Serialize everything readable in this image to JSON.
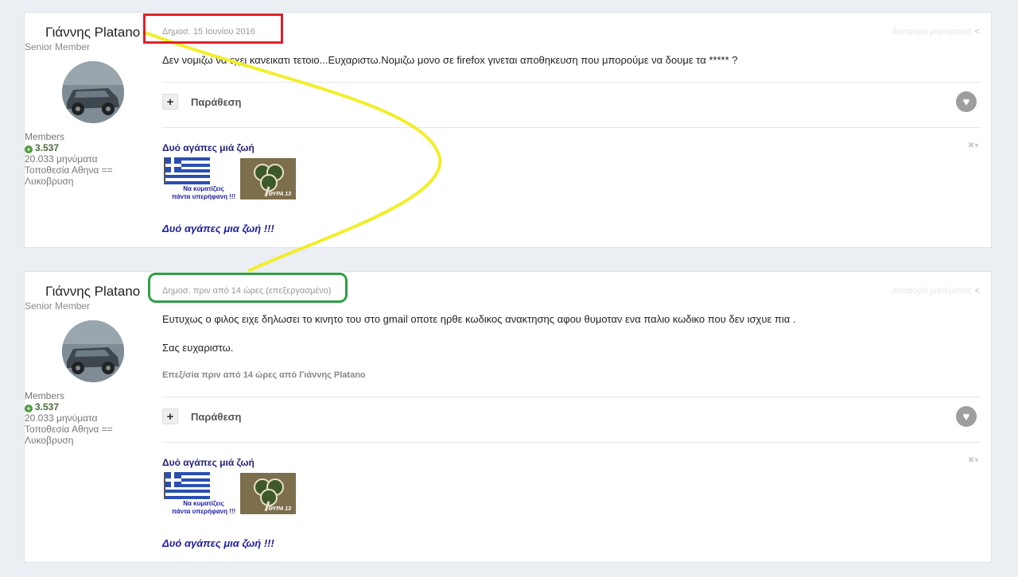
{
  "posts": [
    {
      "author": "Γιάννης Platano",
      "title": "Senior Member",
      "group": "Members",
      "reputation": "3.537",
      "post_count": "20.033 μηνύματα",
      "location_line1": "Τοποθεσία Αθηνα ==",
      "location_line2": "Λυκοβρυση",
      "date": "Δημοσ. 15 Ιουνίου 2016",
      "share_label": "Αναφορά μηνύματος",
      "body_lines": [
        "Δεν νομιζω να εχει κανεικατι τετοιο...Ευχαριστω.Νομιζω μονο σε firefox γινεται αποθηκευση που μπορούμε να δουμε  τα ***** ?"
      ],
      "edit_note": "",
      "quote_label": "Παράθεση",
      "signature": {
        "title": "Δυό αγάπες μιά ζωή",
        "flag_caption_1": "Να κυματίζεις",
        "flag_caption_2": "πάντα υπερήφανη !!!",
        "clover_caption": "ΘΥΡΑ 13",
        "footer": "Δυό αγάπες μια ζωή !!!"
      }
    },
    {
      "author": "Γιάννης Platano",
      "title": "Senior Member",
      "group": "Members",
      "reputation": "3.537",
      "post_count": "20.033 μηνύματα",
      "location_line1": "Τοποθεσία Αθηνα ==",
      "location_line2": "Λυκοβρυση",
      "date": "Δημοσ. πριν από 14 ώρες (επεξεργασμένο)",
      "share_label": "Αναφορά μηνύματος",
      "body_lines": [
        "Ευτυχως ο φιλος ειχε δηλωσει το κινητο του στο gmail οποτε ηρθε κωδικος ανακτησης αφου θυμοταν ενα παλιο κωδικο που δεν ισχυε πια .",
        "Σας ευχαριστω."
      ],
      "edit_note": "Επεξ/σία πριν από 14 ώρες από Γιάννης Platano",
      "quote_label": "Παράθεση",
      "signature": {
        "title": "Δυό αγάπες μιά ζωή",
        "flag_caption_1": "Να κυματίζεις",
        "flag_caption_2": "πάντα υπερήφανη !!!",
        "clover_caption": "ΘΥΡΑ 13",
        "footer": "Δυό αγάπες μια ζωή !!!"
      }
    }
  ],
  "colors": {
    "highlight_red": "#e0202a",
    "highlight_green": "#2ea043",
    "arrow_yellow": "#f2ee2a",
    "signature_blue": "#1f1fa0"
  }
}
